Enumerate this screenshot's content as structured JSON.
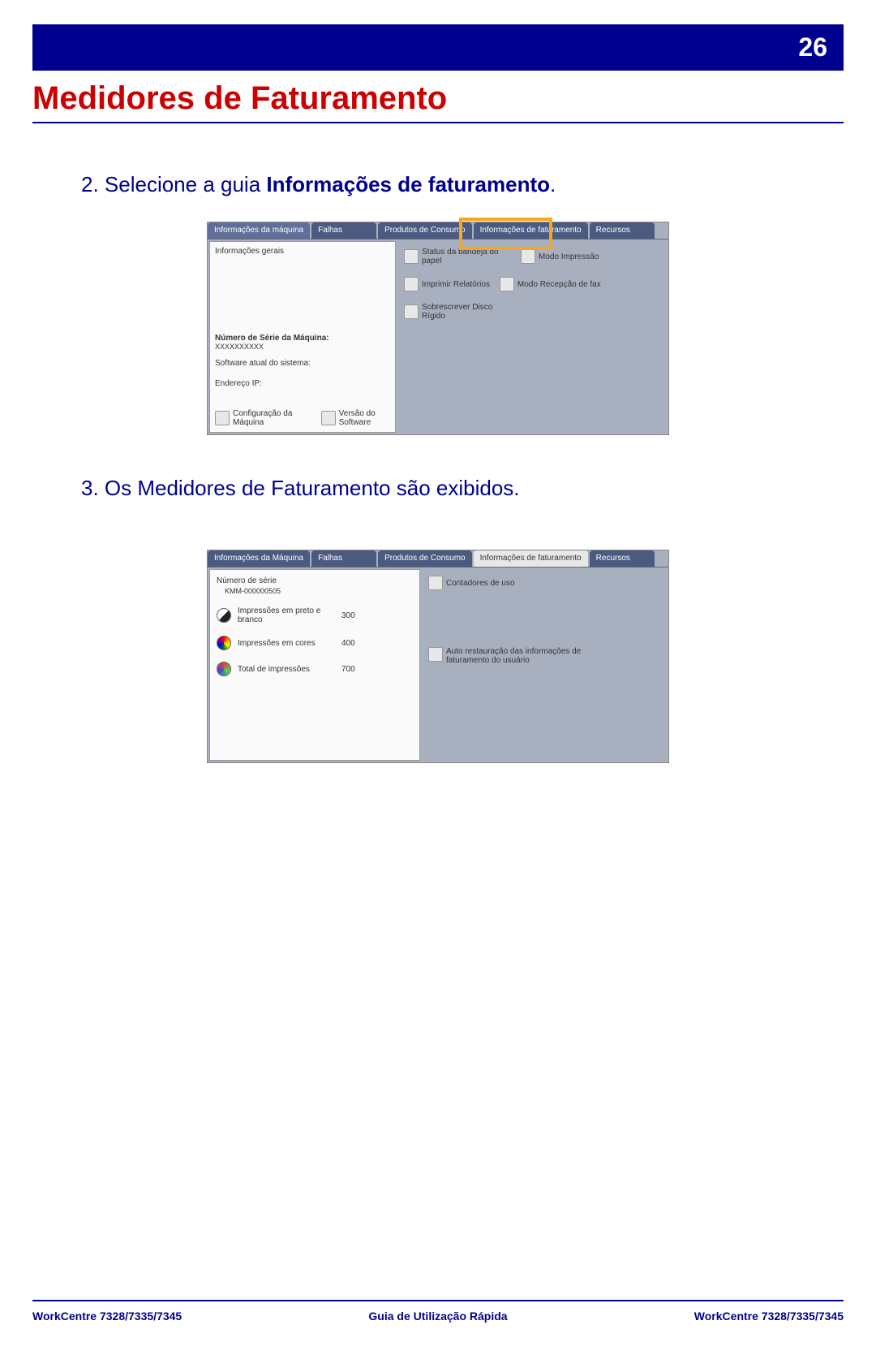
{
  "page": {
    "number": "26",
    "title": "Medidores de Faturamento"
  },
  "step2": {
    "prefix": "2. Selecione a guia ",
    "bold": "Informações de faturamento",
    "suffix": "."
  },
  "step3": "3. Os Medidores de Faturamento são exibidos.",
  "ss1": {
    "tabs": {
      "t0": "Informações da máquina",
      "t1": "Falhas",
      "t2": "Produtos de Consumo",
      "t3": "Informações de faturamento",
      "t4": "Recursos"
    },
    "left": {
      "h": "Informações gerais",
      "serial_l": "Número de Série da Máquina:",
      "serial_v": "XXXXXXXXXX",
      "sw": "Software atual do sistema:",
      "ip": "Endereço IP:",
      "cfg": "Configuração da Máquina",
      "ver": "Versão do Software"
    },
    "right": {
      "r0a": "Status da bandeja do papel",
      "r0b": "Modo Impressão",
      "r1a": "Imprimir Relatórios",
      "r1b": "Modo Recepção de fax",
      "r2a": "Sobrescrever Disco Rígido"
    }
  },
  "ss2": {
    "tabs": {
      "t0": "Informações da Máquina",
      "t1": "Falhas",
      "t2": "Produtos de Consumo",
      "t3": "Informações de faturamento",
      "t4": "Recursos"
    },
    "serial_l": "Número de série",
    "serial_v": "KMM-000000505",
    "m0l": "Impressões em preto e branco",
    "m0v": "300",
    "m1l": "Impressões em cores",
    "m1v": "400",
    "m2l": "Total de impressões",
    "m2v": "700",
    "r0": "Contadores de uso",
    "r1": "Auto restauração das informações de faturamento do usuário"
  },
  "footer": {
    "left": "WorkCentre 7328/7335/7345",
    "center": "Guia de Utilização Rápida",
    "right": "WorkCentre 7328/7335/7345"
  }
}
